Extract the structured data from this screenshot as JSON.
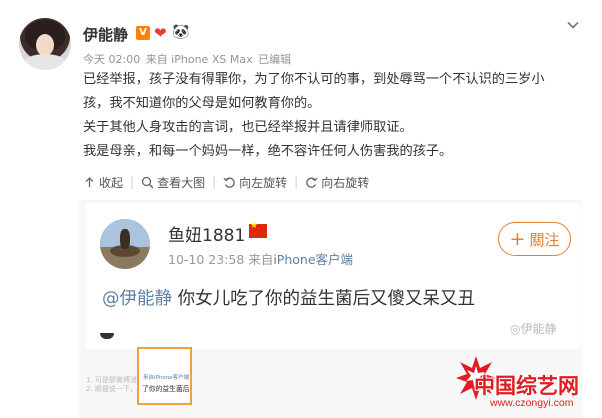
{
  "post": {
    "username": "伊能静",
    "verified_badge": "V",
    "emoji_1": "❤",
    "emoji_2": "🐼",
    "meta": {
      "time": "今天 02:00",
      "source": "来自 iPhone XS Max",
      "edited": "已编辑"
    },
    "text_lines": [
      "已经举报，孩子没有得罪你，为了你不认可的事，到处辱骂一个不认识的三岁小",
      "孩，我不知道你的父母是如何教育你的。",
      "关于其他人身攻击的言词，也已经举报并且请律师取证。",
      "我是母亲，和每一个妈妈一样，绝不容许任何人伤害我的孩子。"
    ],
    "actions": {
      "favorite": "收起",
      "view_large": "查看大图",
      "rotate_left": "向左旋转",
      "rotate_right": "向右旋转"
    }
  },
  "repost": {
    "name": "鱼妞1881",
    "meta_time": "10-10 23:58",
    "meta_source_prefix": "来自",
    "meta_source": "iPhone客户端",
    "follow_label": "關注",
    "mention": "@伊能静",
    "text": " 你女儿吃了你的益生菌后又傻又呆又丑",
    "watermark": "◎伊能静"
  },
  "thumbnails": {
    "left_lines": [
      "1. 可是那微博消",
      "2. 顺便说一下，…"
    ],
    "selected_line1": "来自iPhone客户端",
    "selected_line2": "了你的益生菌后"
  },
  "site_logo": {
    "title": "中国综艺网",
    "url": "www.czongyi.com"
  },
  "colors": {
    "accent_orange": "#ff8200",
    "link_blue": "#5d7fa8",
    "logo_red": "#e11b22"
  }
}
